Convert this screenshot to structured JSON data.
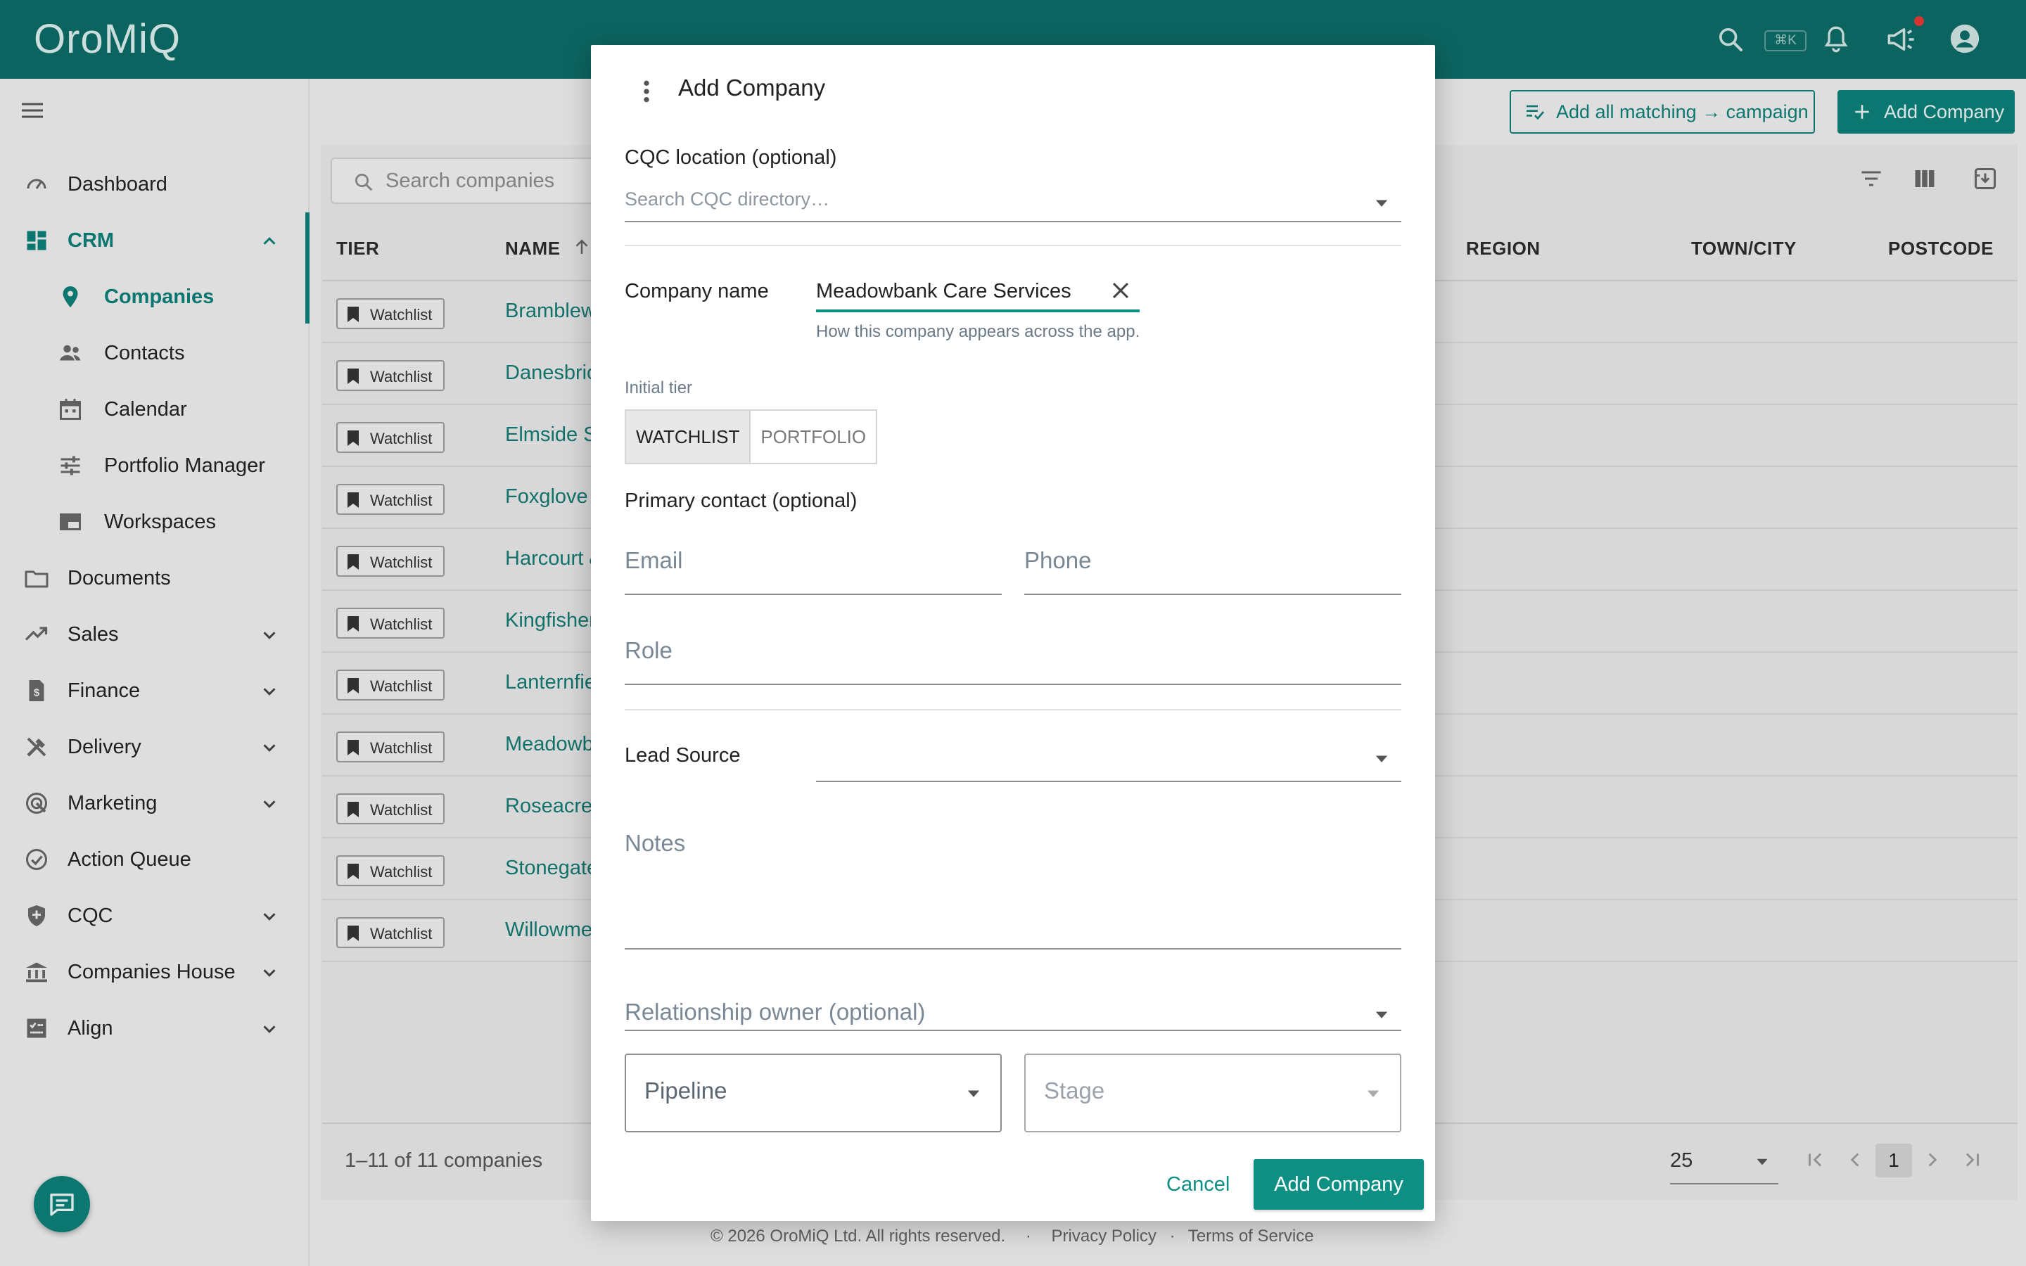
{
  "app": {
    "logo": "OroMiQ",
    "shortcut": "⌘K"
  },
  "sidebar": {
    "items": [
      {
        "label": "Dashboard",
        "icon": "dashboard-icon"
      },
      {
        "label": "CRM",
        "icon": "crm-grid-icon",
        "expanded": true
      },
      {
        "label": "Companies",
        "icon": "location-pin-icon",
        "active": true
      },
      {
        "label": "Contacts",
        "icon": "people-icon"
      },
      {
        "label": "Calendar",
        "icon": "calendar-icon"
      },
      {
        "label": "Portfolio Manager",
        "icon": "sliders-icon"
      },
      {
        "label": "Workspaces",
        "icon": "workspaces-icon"
      },
      {
        "label": "Documents",
        "icon": "folder-icon"
      },
      {
        "label": "Sales",
        "icon": "trending-up-icon"
      },
      {
        "label": "Finance",
        "icon": "invoice-icon"
      },
      {
        "label": "Delivery",
        "icon": "tools-icon"
      },
      {
        "label": "Marketing",
        "icon": "target-icon"
      },
      {
        "label": "Action Queue",
        "icon": "check-circle-icon"
      },
      {
        "label": "CQC",
        "icon": "shield-icon"
      },
      {
        "label": "Companies House",
        "icon": "bank-icon"
      },
      {
        "label": "Align",
        "icon": "checklist-icon"
      }
    ]
  },
  "toolbar": {
    "add_matching": "Add all matching → campaign",
    "add_company": "Add Company"
  },
  "table": {
    "search_placeholder": "Search companies",
    "headers": {
      "tier": "TIER",
      "name": "NAME",
      "region": "REGION",
      "town": "TOWN/CITY",
      "postcode": "POSTCODE"
    },
    "rows": [
      {
        "tier": "Watchlist",
        "name": "Bramblew"
      },
      {
        "tier": "Watchlist",
        "name": "Danesbric"
      },
      {
        "tier": "Watchlist",
        "name": "Elmside S"
      },
      {
        "tier": "Watchlist",
        "name": "Foxglove"
      },
      {
        "tier": "Watchlist",
        "name": "Harcourt &"
      },
      {
        "tier": "Watchlist",
        "name": "Kingfisher"
      },
      {
        "tier": "Watchlist",
        "name": "Lanternfie"
      },
      {
        "tier": "Watchlist",
        "name": "Meadowb"
      },
      {
        "tier": "Watchlist",
        "name": "Roseacre"
      },
      {
        "tier": "Watchlist",
        "name": "Stonegate"
      },
      {
        "tier": "Watchlist",
        "name": "Willowme"
      }
    ],
    "count": "1–11 of 11 companies",
    "page_size": "25",
    "page": "1"
  },
  "footer": {
    "copyright": "© 2026 OroMiQ Ltd. All rights reserved.",
    "sep": "·",
    "privacy": "Privacy Policy",
    "terms": "Terms of Service"
  },
  "modal": {
    "title": "Add Company",
    "cqc_label": "CQC location (optional)",
    "cqc_placeholder": "Search CQC directory…",
    "company_name_label": "Company name",
    "company_name_value": "Meadowbank Care Services",
    "company_name_hint": "How this company appears across the app.",
    "tier_label": "Initial tier",
    "tier_options": [
      "WATCHLIST",
      "PORTFOLIO"
    ],
    "primary_contact_label": "Primary contact (optional)",
    "email_placeholder": "Email",
    "phone_placeholder": "Phone",
    "role_placeholder": "Role",
    "lead_source_label": "Lead Source",
    "notes_placeholder": "Notes",
    "owner_placeholder": "Relationship owner (optional)",
    "pipeline_placeholder": "Pipeline",
    "stage_placeholder": "Stage",
    "cancel": "Cancel",
    "submit": "Add Company"
  },
  "colors": {
    "brand": "#0d6b66",
    "accent": "#0d8f84",
    "link": "#137a72"
  }
}
